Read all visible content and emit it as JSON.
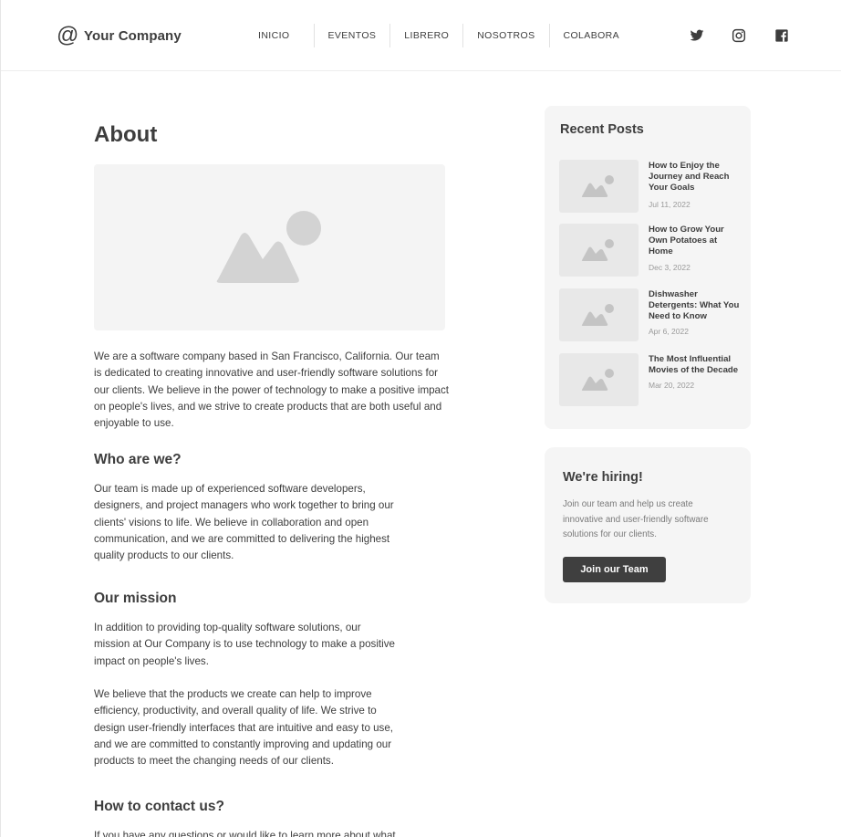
{
  "header": {
    "logo_glyph": "@",
    "company": "Your Company",
    "nav": [
      "INICIO",
      "EVENTOS",
      "LIBRERO",
      "NOSOTROS",
      "COLABORA"
    ],
    "social_icons": [
      "twitter-icon",
      "instagram-icon",
      "facebook-icon"
    ]
  },
  "main": {
    "title": "About",
    "intro": "We are a software company based in San Francisco, California. Our team is dedicated to creating innovative and user-friendly software solutions for our clients. We believe in the power of technology to make a positive impact on people's lives, and we strive to create products that are both useful and enjoyable to use.",
    "who_heading": "Who are we?",
    "who_text": "Our team is made up of experienced software developers, designers, and project managers who work together to bring our clients' visions to life. We believe in collaboration and open communication, and we are committed to delivering the highest quality products to our clients.",
    "mission_heading": "Our mission",
    "mission_text_1": "In addition to providing top-quality software solutions, our mission at Our Company is to use technology to make a positive impact on people's lives.",
    "mission_text_2": "We believe that the products we create can help to improve efficiency, productivity, and overall quality of life. We strive to design user-friendly interfaces that are intuitive and easy to use, and we are committed to constantly improving and updating our products to meet the changing needs of our clients.",
    "contact_heading": "How to contact us?",
    "contact_text": "If you have any questions or would like to learn more about what"
  },
  "recent_posts": {
    "heading": "Recent Posts",
    "items": [
      {
        "title": "How to Enjoy the Journey and Reach Your Goals",
        "date": "Jul 11, 2022"
      },
      {
        "title": "How to Grow Your Own Potatoes at Home",
        "date": "Dec 3, 2022"
      },
      {
        "title": "Dishwasher Detergents: What You Need to Know",
        "date": "Apr 6, 2022"
      },
      {
        "title": "The Most Influential Movies of the Decade",
        "date": "Mar 20, 2022"
      }
    ]
  },
  "hiring": {
    "heading": "We're hiring!",
    "text": "Join our team and help us create innovative and user-friendly software solutions for our clients.",
    "button": "Join our Team"
  },
  "colors": {
    "text": "#3d3d3d",
    "card_bg": "#f5f5f5",
    "placeholder": "#d0d0d0",
    "button_bg": "#3f3f3f"
  }
}
